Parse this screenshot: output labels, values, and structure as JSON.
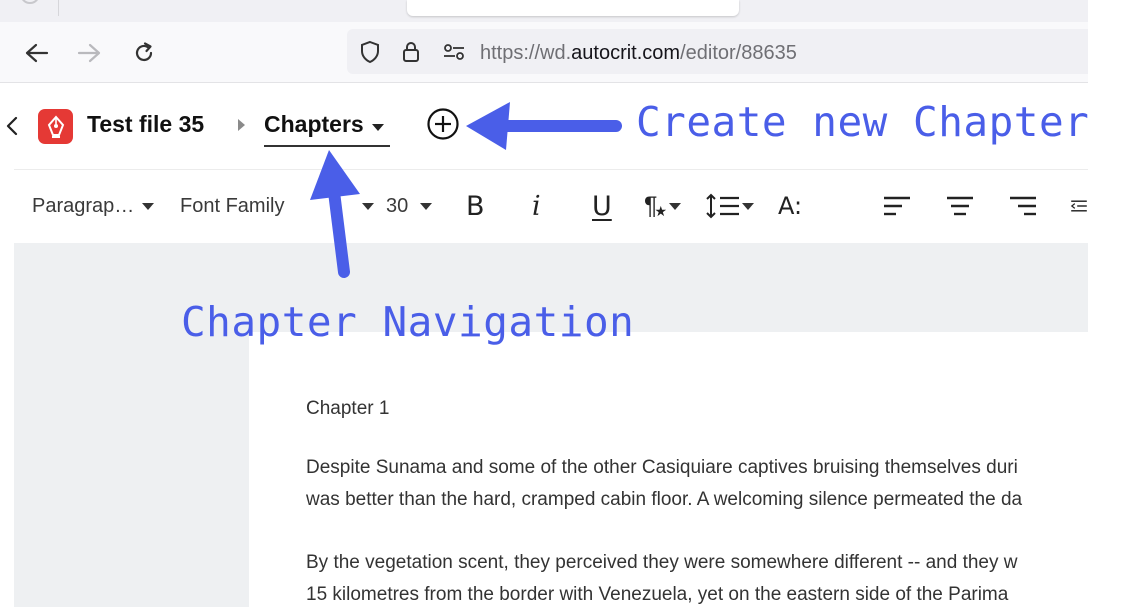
{
  "browser": {
    "url_prefix": "https://wd.",
    "url_domain": "autocrit.com",
    "url_path": "/editor/88635",
    "icons": [
      "back-arrow-icon",
      "forward-arrow-icon",
      "reload-icon",
      "shield-icon",
      "lock-icon",
      "permissions-icon"
    ]
  },
  "editor": {
    "file_title": "Test file 35",
    "chapters_label": "Chapters"
  },
  "toolbar": {
    "paragraph_label": "Paragrap…",
    "font_family_label": "Font Family",
    "font_size": "30",
    "bold_label": "B",
    "italic_label": "i",
    "underline_label": "U",
    "special_char_label": "¶",
    "font_style_label": "A:"
  },
  "document": {
    "heading": "Chapter 1",
    "paragraphs": [
      [
        "Despite Sunama and some of the other Casiquiare captives bruising themselves duri",
        "was better than the hard, cramped cabin floor. A welcoming silence permeated the da"
      ],
      [
        "By the vegetation scent, they perceived they were somewhere different -- and they w",
        "15 kilometres from the border with Venezuela, yet on the eastern side of the Parima"
      ]
    ]
  },
  "annotations": {
    "create_chapter": "Create new Chapter",
    "chapter_navigation": "Chapter Navigation",
    "color": "#4a5ee8"
  },
  "colors": {
    "logo": "#e53935",
    "doc_background": "#eef0f2"
  }
}
